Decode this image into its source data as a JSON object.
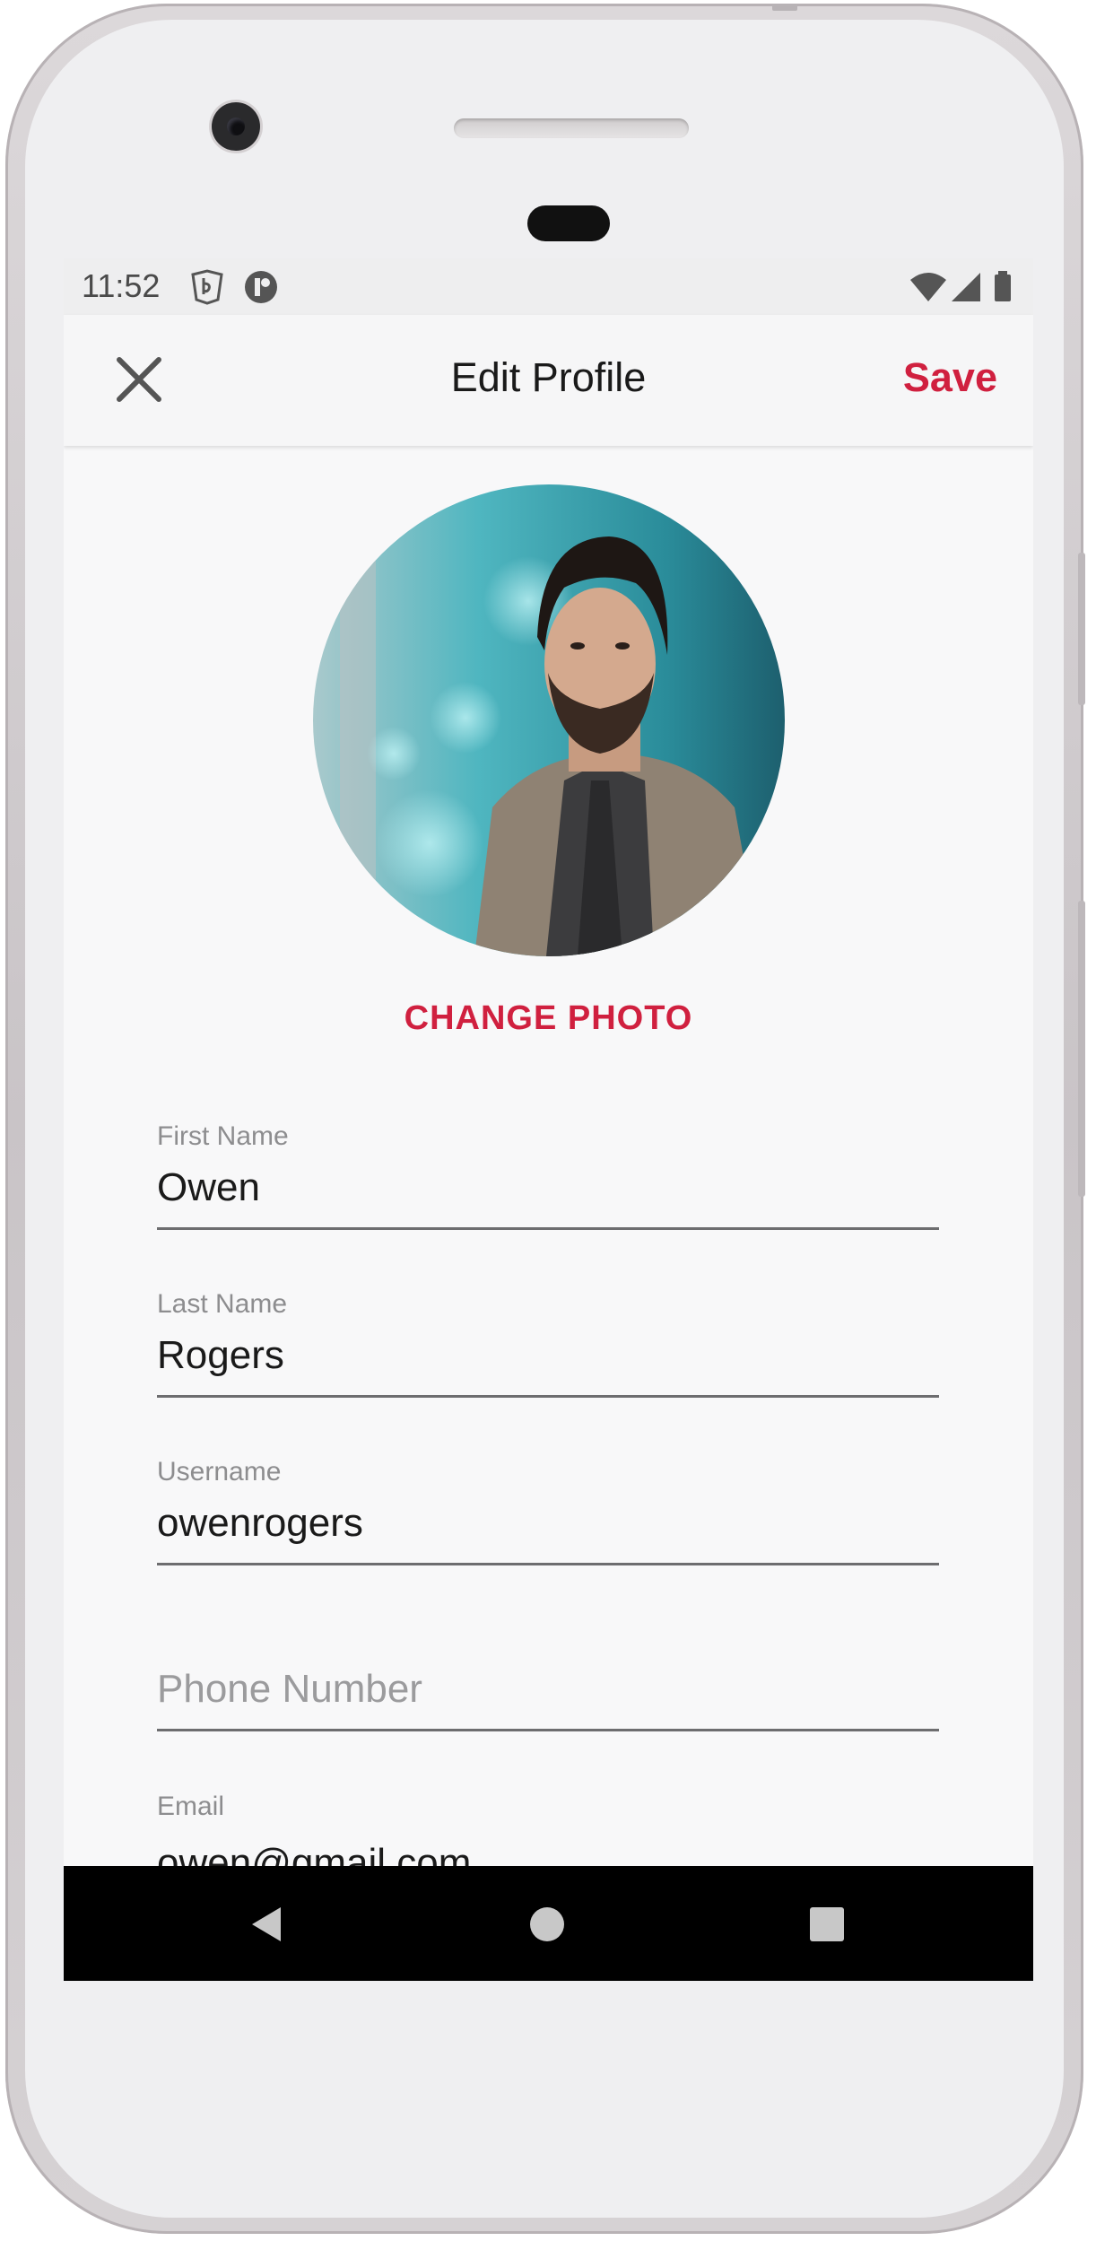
{
  "status_bar": {
    "time": "11:52",
    "icons": [
      "shield-notification-icon",
      "app-notification-icon",
      "wifi-icon",
      "cellular-signal-icon",
      "battery-icon"
    ]
  },
  "app_bar": {
    "title": "Edit Profile",
    "close_icon": "close-icon",
    "save_label": "Save"
  },
  "profile": {
    "change_photo_label": "CHANGE PHOTO"
  },
  "form": {
    "first_name": {
      "label": "First Name",
      "value": "Owen"
    },
    "last_name": {
      "label": "Last Name",
      "value": "Rogers"
    },
    "username": {
      "label": "Username",
      "value": "owenrogers"
    },
    "phone": {
      "label": "",
      "value": "",
      "placeholder": "Phone Number"
    },
    "email": {
      "label": "Email",
      "value": "owen@gmail.com"
    }
  },
  "nav_bar": {
    "icons": [
      "back-icon",
      "home-icon",
      "recents-icon"
    ]
  },
  "colors": {
    "accent": "#d0203f",
    "background": "#f8f8f9",
    "nav_bar": "#000000"
  }
}
